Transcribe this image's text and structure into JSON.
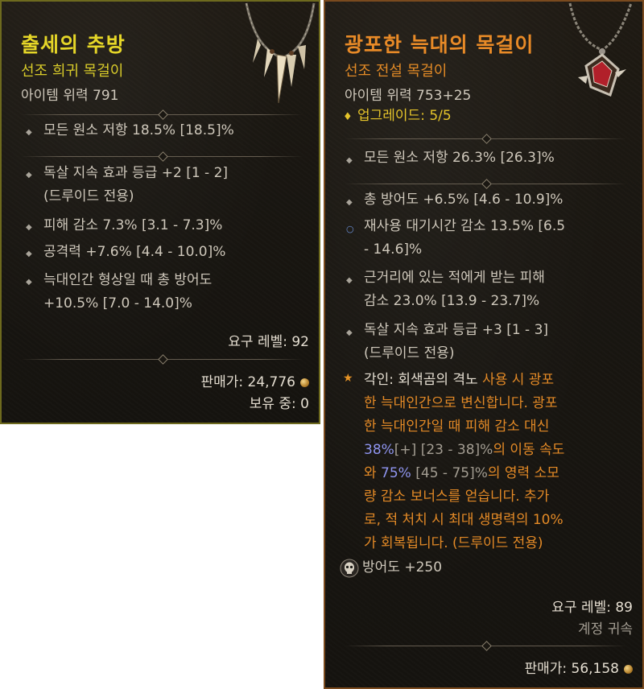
{
  "left_item": {
    "name": "출세의 추방",
    "rarity_type": "선조 희귀 목걸이",
    "item_power": "아이템 위력 791",
    "base_stats": [
      "모든 원소 저항 18.5% [18.5]%"
    ],
    "affixes": [
      {
        "lines": [
          "독살 지속 효과 등급 +2 [1 - 2]",
          "(드루이드 전용)"
        ]
      },
      {
        "lines": [
          "피해 감소 7.3% [3.1 - 7.3]%"
        ]
      },
      {
        "lines": [
          "공격력 +7.6% [4.4 - 10.0]%"
        ]
      },
      {
        "lines": [
          "늑대인간 형상일 때 총 방어도",
          "+10.5% [7.0 - 14.0]%"
        ]
      }
    ],
    "required_level": "요구 레벨: 92",
    "sell_value": "판매가: 24,776",
    "owned": "보유 중: 0",
    "colors": {
      "name": "#e5d628",
      "rarity": "#d8cb2a",
      "border": "#6e6a1e"
    },
    "icons": [
      "diamond-bullet-icon",
      "gold-coin-icon",
      "tooth-necklace-icon"
    ]
  },
  "right_item": {
    "name": "광포한 늑대의 목걸이",
    "rarity_type": "선조 전설 목걸이",
    "item_power": "아이템 위력 753+25",
    "upgrade": "업그레이드: 5/5",
    "base_stats": [
      "모든 원소 저항 26.3% [26.3]%"
    ],
    "affixes": [
      {
        "bullet": "diamond",
        "lines": [
          "총 방어도 +6.5% [4.6 - 10.9]%"
        ]
      },
      {
        "bullet": "circle-blue",
        "lines": [
          "재사용 대기시간 감소 13.5% [6.5",
          "- 14.6]%"
        ]
      },
      {
        "bullet": "diamond",
        "lines": [
          "근거리에 있는 적에게 받는 피해",
          "감소 23.0% [13.9 - 23.7]%"
        ]
      },
      {
        "bullet": "diamond",
        "lines": [
          "독살 지속 효과 등급 +3 [1 - 3]",
          "(드루이드 전용)"
        ]
      }
    ],
    "aspect": {
      "label": "각인:",
      "skill": "회색곰의 격노",
      "line1_rest": "사용 시 광포",
      "line2": "한 늑대인간으로 변신합니다. 광포",
      "line3": "한 늑대인간일 때 피해 감소 대신",
      "value1": "38%",
      "value1_extra": "[+] [23 - 38]%",
      "line4_rest": "의 이동 속도",
      "line5_start": "와",
      "value2": "75%",
      "value2_extra": "[45 - 75]%",
      "line5_rest": "의 영력 소모",
      "line6": "량 감소 보너스를 얻습니다. 추가",
      "line7": "로, 적 처치 시 최대 생명력의 10%",
      "line8": "가 회복됩니다. (드루이드 전용)"
    },
    "socket": "방어도 +250",
    "required_level": "요구 레벨: 89",
    "account_bound": "계정 귀속",
    "sell_value": "판매가: 56,158",
    "colors": {
      "name": "#e88a27",
      "rarity": "#e28a26",
      "border": "#7a4a1e",
      "value_highlight": "#8f95f0"
    },
    "icons": [
      "diamond-bullet-icon",
      "circle-bullet-icon",
      "star-bullet-icon",
      "skull-gem-icon",
      "gold-coin-icon",
      "pendant-necklace-icon"
    ]
  }
}
